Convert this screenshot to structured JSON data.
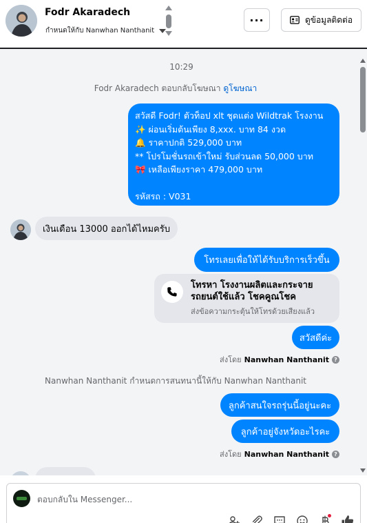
{
  "header": {
    "contact_name": "Fodr Akaradech",
    "assign_label": "กำหนดให้กับ Nanwhan Nanthanit",
    "more_label": "···",
    "contact_info_label": "ดูข้อมูลติดต่อ"
  },
  "conversation": {
    "timestamp": "10:29",
    "ad_reply_prefix": "Fodr Akaradech ตอบกลับโฆษณา",
    "ad_reply_link": "ดูโฆษณา",
    "promo": {
      "line1": "สวัสดี Fodr! ตัวท็อป xlt ชุดแต่ง Wildtrak โรงงาน",
      "line2": "✨  ผ่อนเริ่มต้นเพียง 8,xxx. บาท 84 งวด",
      "line3": "🔔 ราคาปกติ 529,000 บาท",
      "line4": "** โปรโมชั่นรถเข้าใหม่ รับส่วนลด 50,000 บาท",
      "line5": "🎀  เหลือเพียงราคา 479,000 บาท",
      "line6": "รหัสรถ : V031"
    },
    "incoming_message": "เงินเดือน 13000 ออกได้ไหมครับ",
    "call_cta": "โทรเลยเพื่อให้ได้รับบริการเร็วขึ้น",
    "call_card": {
      "title": "โทรหา โรงงานผลิตและกระจายรถยนต์ใช้แล้ว โชคคูณโชค",
      "subtitle": "ส่งข้อความกระตุ้นให้โทรด้วยเสียงแล้ว"
    },
    "greeting": "สวัสดีค่ะ",
    "sent_by_label": "ส่งโดย",
    "sent_by_name": "Nanwhan Nanthanit",
    "system_note": "Nanwhan Nanthanit กำหนดการสนทนานี้ให้กับ Nanwhan Nanthanit",
    "question1": "ลูกค้าสนใจรถรุ่นนี้อยู่นะคะ",
    "question2": "ลูกค้าอยู่จังหวัดอะไรคะ"
  },
  "composer": {
    "placeholder": "ตอบกลับใน Messenger..."
  },
  "colors": {
    "accent": "#0084ff",
    "incoming_bubble": "#e4e6eb",
    "background": "#f3f4f6"
  },
  "icons": [
    "more-icon",
    "contact-card-icon",
    "phone-icon",
    "info-icon",
    "add-contact-icon",
    "attach-icon",
    "saved-reply-icon",
    "emoji-icon",
    "currency-icon",
    "like-icon"
  ]
}
